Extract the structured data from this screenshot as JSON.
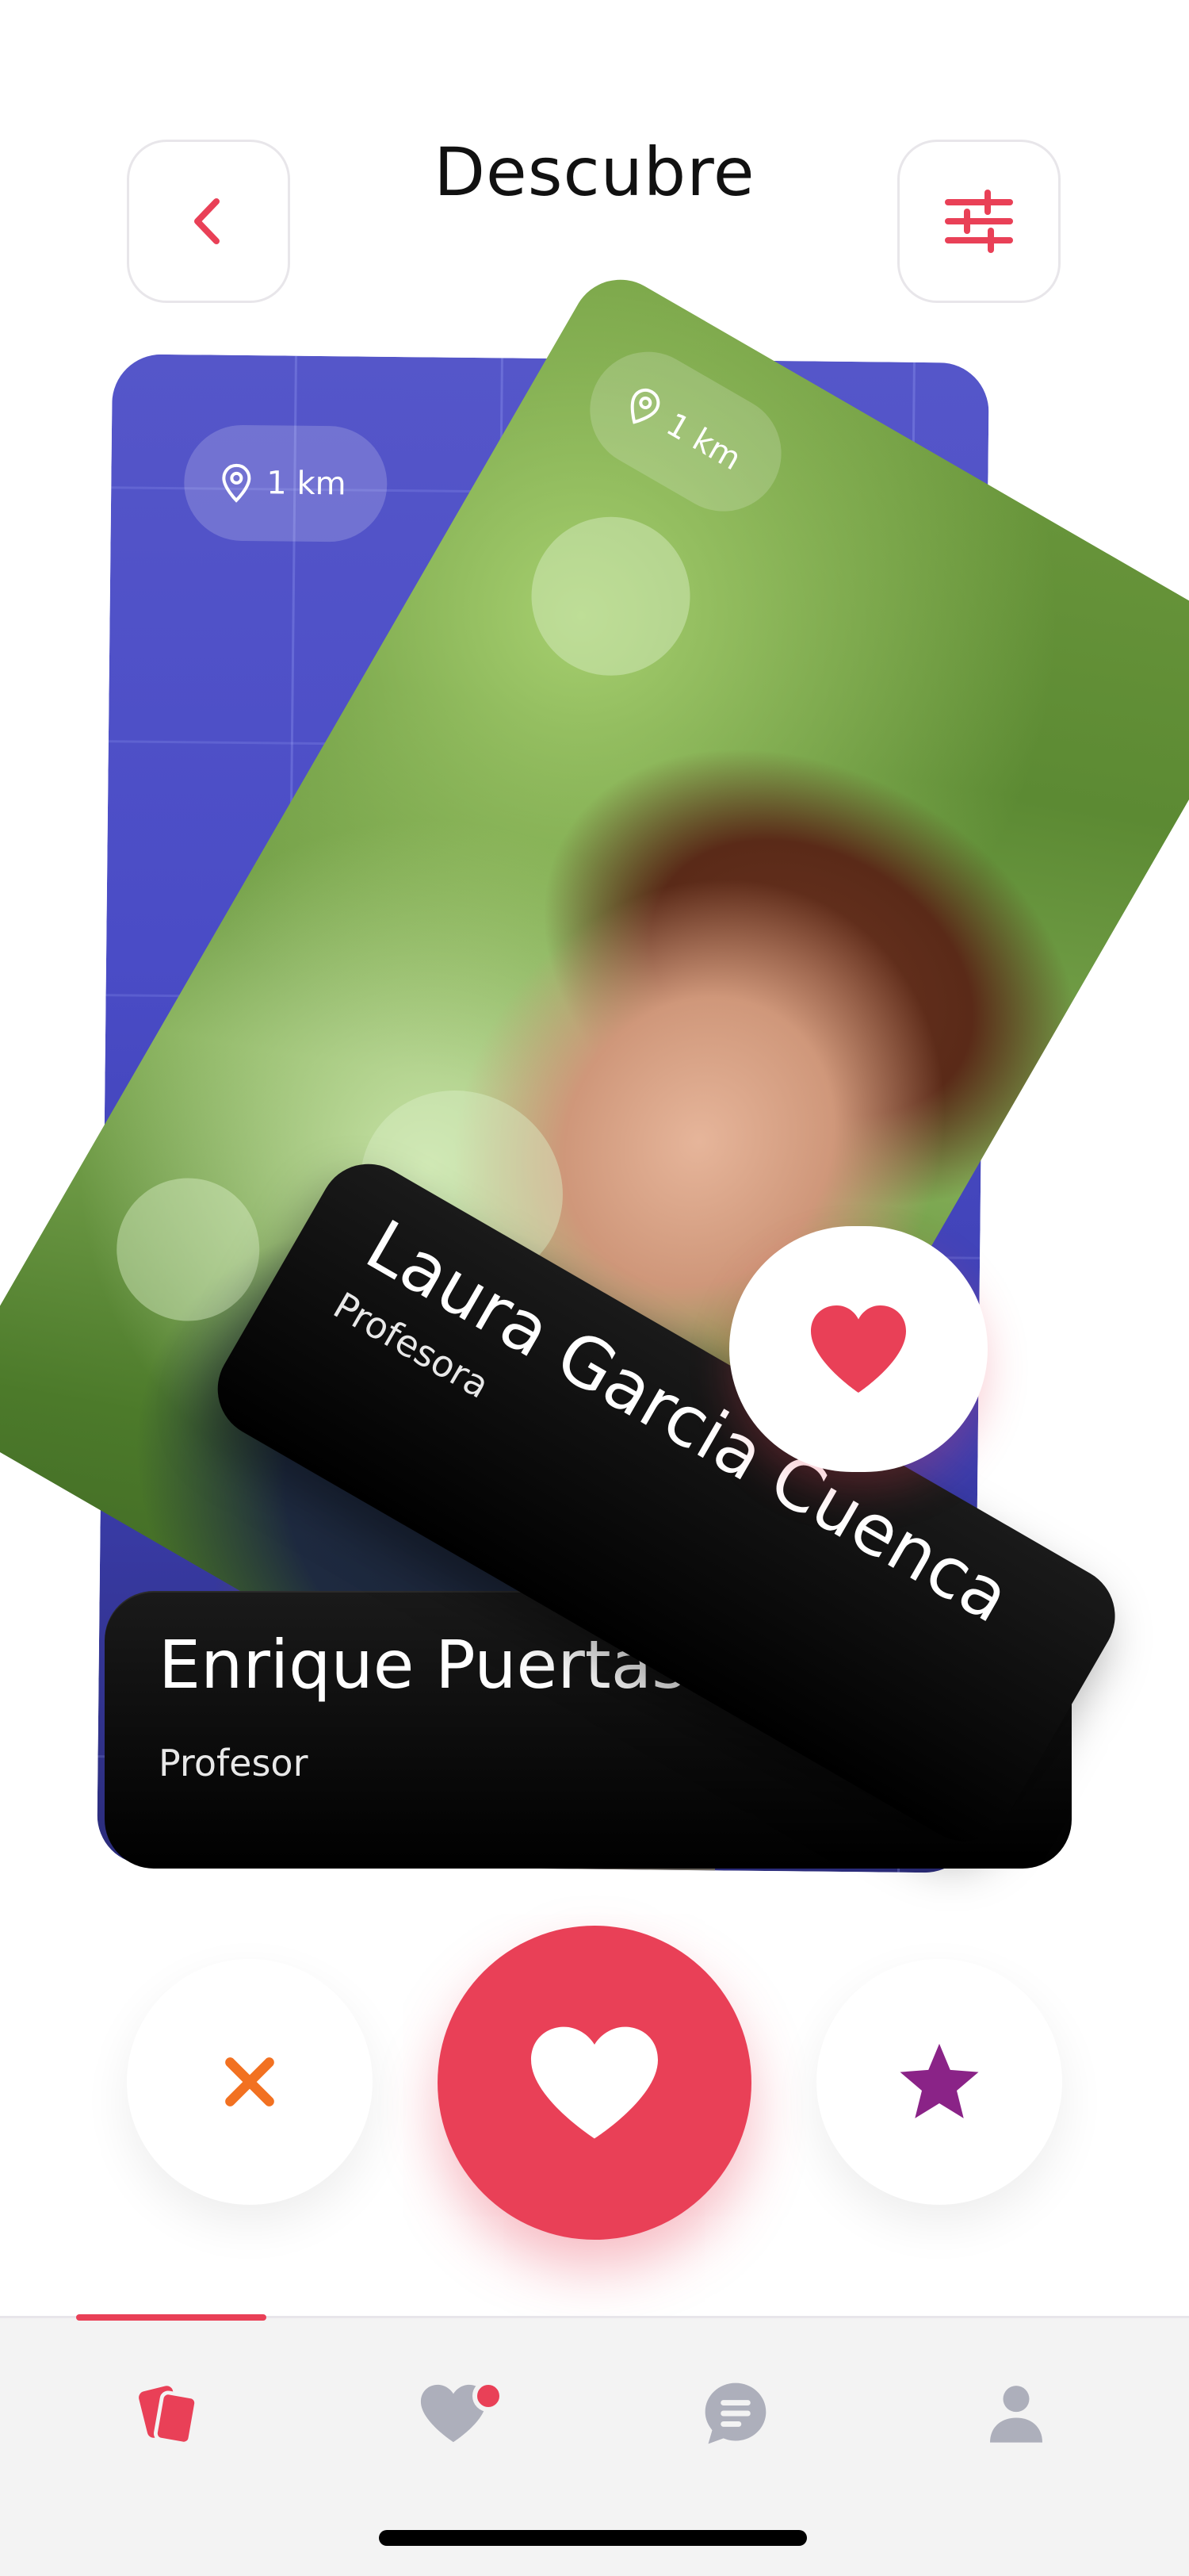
{
  "header": {
    "title": "Descubre",
    "back_icon": "chevron-left-icon",
    "filter_icon": "sliders-icon"
  },
  "cards": [
    {
      "name": "Enrique Puertas",
      "role": "Profesor",
      "distance": "1 km"
    },
    {
      "name": "Laura Garcia Cuenca",
      "role": "Profesora",
      "distance": "1 km"
    }
  ],
  "actions": {
    "pass_icon": "close-icon",
    "like_icon": "heart-icon",
    "superlike_icon": "star-icon"
  },
  "tabs": [
    {
      "name": "cards",
      "icon": "cards-icon",
      "active": true
    },
    {
      "name": "matches",
      "icon": "heart-icon",
      "badge": true
    },
    {
      "name": "chat",
      "icon": "chat-icon"
    },
    {
      "name": "profile",
      "icon": "person-icon"
    }
  ],
  "colors": {
    "accent": "#E94057",
    "pass": "#F27121",
    "star": "#8A2387",
    "inactive_icon": "#ADAFBB"
  }
}
